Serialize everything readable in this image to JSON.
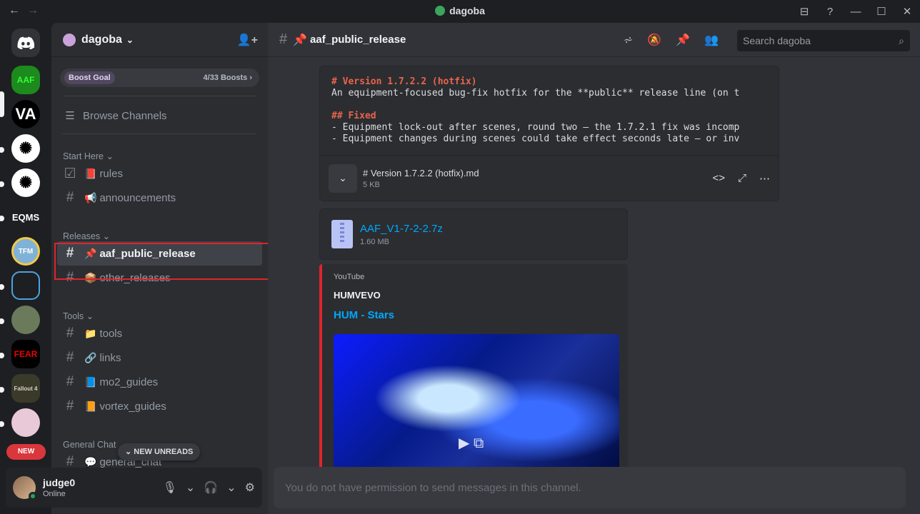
{
  "window": {
    "title": "dagoba",
    "accent": "#3ba55d"
  },
  "guilds": [
    {
      "label": "",
      "color": "#5865f2",
      "icon": "discord-icon"
    },
    {
      "label": "AAF",
      "color": "#1c8a1c"
    },
    {
      "label": "VA",
      "color": "#000000"
    },
    {
      "label": "",
      "color": "#ffffff"
    },
    {
      "label": "",
      "color": "#ffffff"
    },
    {
      "label": "EQMS",
      "color": "#1e1f22"
    },
    {
      "label": "TFM",
      "color": "#7fb2d6"
    },
    {
      "label": "",
      "color": "#1e1f22"
    },
    {
      "label": "",
      "color": "#6b7a5a"
    },
    {
      "label": "FEAR",
      "color": "#000000"
    },
    {
      "label": "Fallout 4",
      "color": "#3a3a2a"
    },
    {
      "label": "",
      "color": "#e9c9d8"
    }
  ],
  "new_badge": "NEW",
  "server": {
    "name": "dagoba",
    "boost_label": "Boost Goal",
    "boost_count": "4/33 Boosts",
    "browse": "Browse Channels"
  },
  "categories": {
    "start": "Start Here",
    "releases": "Releases",
    "tools": "Tools",
    "general": "General Chat"
  },
  "channels": {
    "rules": {
      "name": "rules",
      "emoji": "📕"
    },
    "announcements": {
      "name": "announcements",
      "emoji": "📢"
    },
    "aaf_public_release": {
      "name": "aaf_public_release",
      "emoji": "📌"
    },
    "other_releases": {
      "name": "other_releases",
      "emoji": "📦"
    },
    "tools": {
      "name": "tools",
      "emoji": "📁"
    },
    "links": {
      "name": "links",
      "emoji": "🔗"
    },
    "mo2_guides": {
      "name": "mo2_guides",
      "emoji": "📘"
    },
    "vortex_guides": {
      "name": "vortex_guides",
      "emoji": "📙"
    },
    "general": {
      "name": "general_chat",
      "emoji": "💬"
    }
  },
  "new_unreads": "NEW UNREADS",
  "user": {
    "name": "judge0",
    "status": "Online"
  },
  "chat": {
    "channel": "aaf_public_release",
    "search_placeholder": "Search dagoba",
    "code_lines": [
      "# Version 1.7.2.2 (hotfix)",
      "An equipment-focused bug-fix hotfix for the **public** release line (on t",
      "",
      "## Fixed",
      "- Equipment lock-out after scenes, round two — the 1.7.2.1 fix was incomp",
      "- Equipment changes during scenes could take effect seconds late — or inv"
    ],
    "code_file_name": "# Version 1.7.2.2 (hotfix).md",
    "code_file_size": "5 KB",
    "attachment_name": "AAF_V1-7-2-2.7z",
    "attachment_size": "1.60 MB",
    "embed": {
      "provider": "YouTube",
      "author": "HUMVEVO",
      "title": "HUM - Stars",
      "border_color": "#e0242b"
    },
    "input_placeholder": "You do not have permission to send messages in this channel."
  }
}
